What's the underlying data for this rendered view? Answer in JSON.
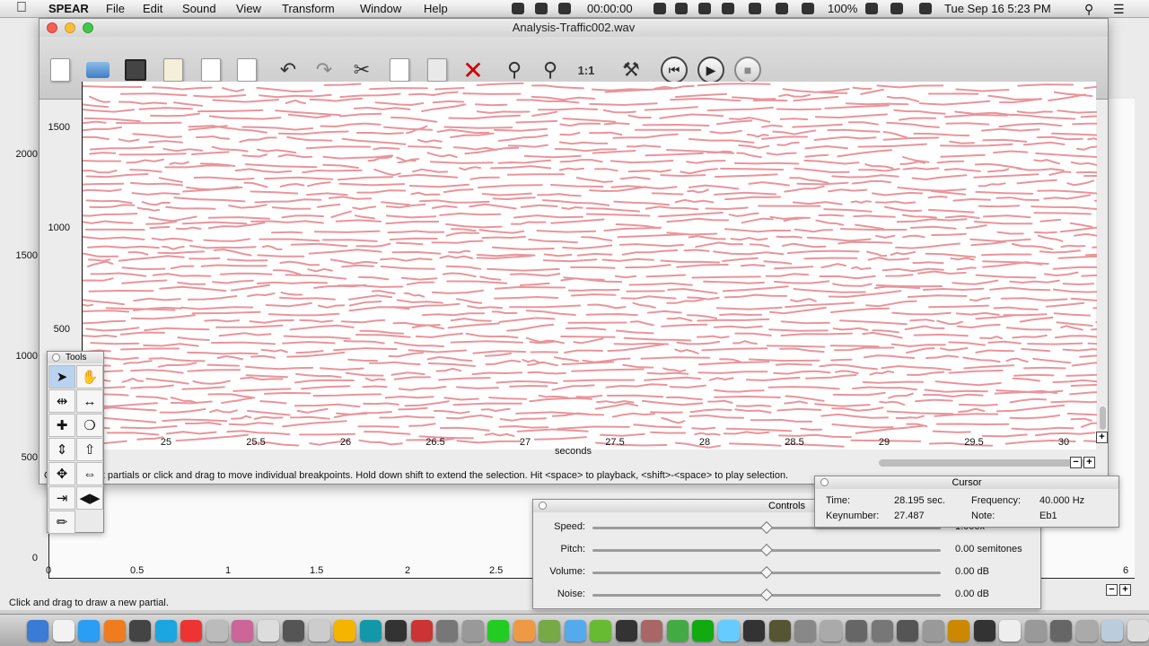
{
  "menubar": {
    "app_name": "SPEAR",
    "menus": [
      "File",
      "Edit",
      "Sound",
      "View",
      "Transform",
      "Window",
      "Help"
    ],
    "timer": "00:00:00",
    "battery": "100%",
    "datetime": "Tue Sep 16  5:23 PM"
  },
  "window": {
    "title": "Analysis-Traffic002.wav"
  },
  "toolbar": {
    "buttons": [
      "new-file",
      "open-file",
      "save-file",
      "edit-file",
      "import-file",
      "export-file",
      "undo",
      "redo",
      "cut",
      "copy",
      "paste",
      "delete",
      "zoom-out",
      "zoom-in",
      "zoom-1to1",
      "tools",
      "rewind",
      "play",
      "stop"
    ],
    "zoom_1to1_label": "1:1"
  },
  "plot": {
    "y_ticks": [
      "1500",
      "1000",
      "500"
    ],
    "x_ticks": [
      "25",
      "25.5",
      "26",
      "26.5",
      "27",
      "27.5",
      "28",
      "28.5",
      "29",
      "29.5",
      "30"
    ],
    "x_label": "seconds",
    "status_text": "Click to select partials or click and drag to move individual breakpoints. Hold down shift to extend the selection. Hit <space> to playback, <shift>-<space> to play selection."
  },
  "background_plot": {
    "y_ticks": [
      "2000",
      "1500",
      "1000",
      "500",
      "0"
    ],
    "x_ticks": [
      "0",
      "0.5",
      "1",
      "1.5",
      "2",
      "2.5",
      "6"
    ]
  },
  "tools": {
    "title": "Tools"
  },
  "controls": {
    "title": "Controls",
    "rows": [
      {
        "label": "Speed:",
        "value": "1.000x",
        "level": 0.5
      },
      {
        "label": "Pitch:",
        "value": "0.00 semitones",
        "level": 0.5
      },
      {
        "label": "Volume:",
        "value": "0.00 dB",
        "level": 0.5
      },
      {
        "label": "Noise:",
        "value": "0.00 dB",
        "level": 0.5
      }
    ]
  },
  "cursor": {
    "title": "Cursor",
    "time_label": "Time:",
    "time_value": "28.195 sec.",
    "frequency_label": "Frequency:",
    "frequency_value": "40.000 Hz",
    "keynumber_label": "Keynumber:",
    "keynumber_value": "27.487",
    "note_label": "Note:",
    "note_value": "Eb1"
  },
  "status_bar": {
    "text": "Click and drag to draw a new partial."
  },
  "colors": {
    "partials": "#e8959b",
    "plot_bg": "#ffffff",
    "window_bg": "#ececec"
  }
}
